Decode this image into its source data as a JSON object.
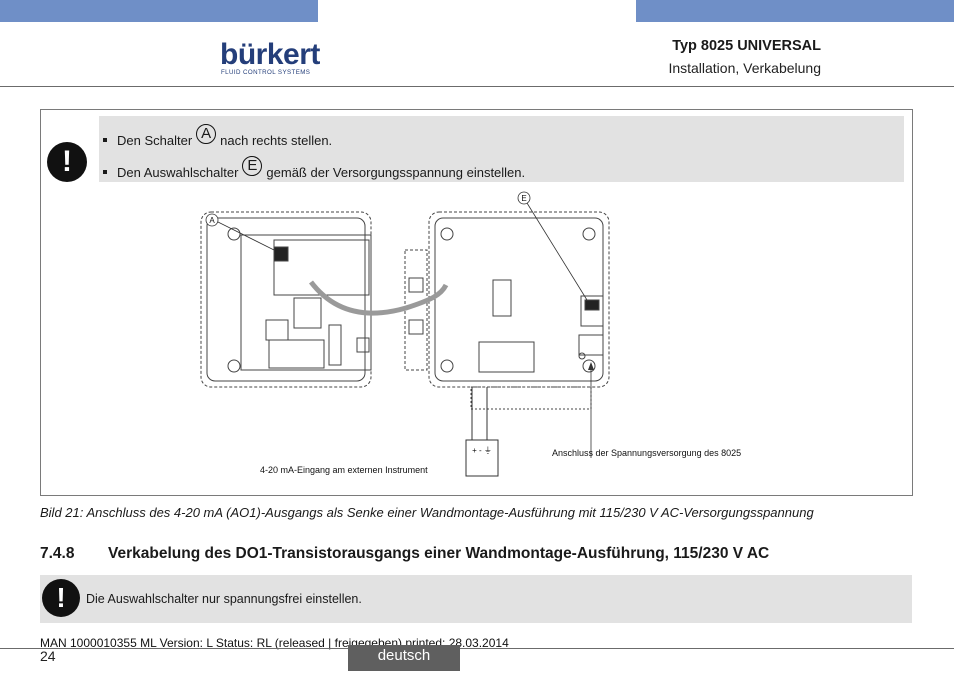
{
  "header": {
    "logo_text": "bürkert",
    "logo_subtitle": "FLUID CONTROL SYSTEMS",
    "title": "Typ 8025 UNIVERSAL",
    "subtitle": "Installation, Verkabelung"
  },
  "warning": {
    "bullets": [
      {
        "before": "Den Schalter",
        "marker": "A",
        "after": "nach rechts stellen."
      },
      {
        "before": "Den Auswahlschalter",
        "marker": "E",
        "after": "gemäß der Versorgungsspannung einstellen."
      }
    ]
  },
  "diagram": {
    "callout_a": "A",
    "callout_e": "E",
    "label_input": "4-20 mA-Eingang am externen Instrument",
    "label_supply": "Anschluss der Spannungsversorgung des 8025",
    "instrument_terminals": "+ - ⏚"
  },
  "caption": "Bild 21:  Anschluss des 4-20 mA (AO1)-Ausgangs als Senke einer Wandmontage-Ausführung mit 115/230 V AC-Versorgungsspannung",
  "section": {
    "number": "7.4.8",
    "title": "Verkabelung des DO1-Transistorausgangs einer Wandmontage-Ausführung, 115/230 V AC"
  },
  "note": {
    "text": "Die Auswahlschalter nur spannungsfrei einstellen."
  },
  "footer": {
    "meta": "MAN  1000010355  ML  Version: L Status: RL (released | freigegeben)  printed: 28.03.2014",
    "page": "24",
    "language": "deutsch"
  },
  "colors": {
    "top_bar": "#6f8fc7",
    "logo": "#243e7a",
    "strip": "#e2e2e2",
    "language_tab": "#5f5f5f"
  }
}
